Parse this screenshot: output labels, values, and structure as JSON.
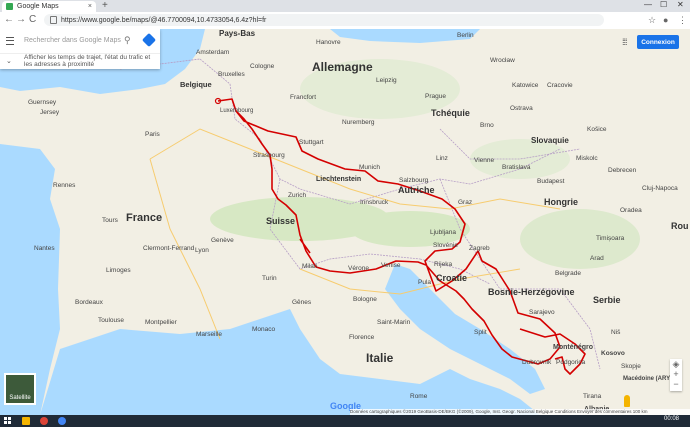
{
  "browser": {
    "tab_title": "Google Maps",
    "tab_close": "×",
    "new_tab": "+",
    "url": "https://www.google.be/maps/@46.7700094,10.4733054,6.4z?hl=fr",
    "nav_back": "←",
    "nav_forward": "→",
    "nav_reload": "C",
    "window_min": "—",
    "window_max": "☐",
    "window_close": "✕"
  },
  "maps": {
    "search_placeholder": "Rechercher dans Google Maps",
    "hint_text": "Afficher les temps de trajet, l'état du trafic et les adresses à proximité",
    "signin_label": "Connexion",
    "satellite_label": "Satellite",
    "google_logo": "Google",
    "zoom_in": "+",
    "zoom_out": "−",
    "footer_text": "Données cartographiques ©2019 GeoBasis-DE/BKG (©2009), Google, Inst. Geogr. Nacional   Belgique   Conditions   Envoyer des commentaires   100 km"
  },
  "map_labels": {
    "countries": [
      "Pays-Bas",
      "Allemagne",
      "Belgique",
      "Luxembourg",
      "Tchéquie",
      "Slovaquie",
      "France",
      "Suisse",
      "Liechtenstein",
      "Autriche",
      "Hongrie",
      "Slovénie",
      "Croatie",
      "Bosnie-Herzégovine",
      "Serbie",
      "Italie",
      "Monténégro",
      "Albanie",
      "Kosovo",
      "Macédoine (ARYM)",
      "Rou"
    ],
    "cities": [
      "Amsterdam",
      "Berlin",
      "Hanovre",
      "Leipzig",
      "Wrocław",
      "Cologne",
      "Francfort",
      "Prague",
      "Katowice",
      "Cracovie",
      "Ostrava",
      "Nuremberg",
      "Stuttgart",
      "Munich",
      "Brno",
      "Vienne",
      "Bratislava",
      "Košice",
      "Paris",
      "Strasbourg",
      "Zurich",
      "Salzbourg",
      "Graz",
      "Budapest",
      "Cluj-Napoca",
      "Genève",
      "Lyon",
      "Milan",
      "Turin",
      "Venise",
      "Zagreb",
      "Timișoara",
      "Belgrade",
      "Marseille",
      "Montpellier",
      "Monaco",
      "Gênes",
      "Bologne",
      "Florence",
      "Sarajevo",
      "Podgorica",
      "Tirana",
      "Skopje",
      "Rome",
      "Nantes",
      "Tours",
      "Bordeaux",
      "Toulouse",
      "Clermont-Ferrand",
      "Limoges",
      "Rennes",
      "Guernsey",
      "Jersey",
      "Vérone",
      "Saint-Marin",
      "Ljubljana",
      "Split",
      "Dubrovnik",
      "Niš",
      "Debrecen",
      "Miskolc",
      "Oradea",
      "Linz",
      "Innsbruck",
      "Arad",
      "Pula",
      "Rijeka",
      "Cracovie",
      "Bruxelles"
    ]
  }
}
